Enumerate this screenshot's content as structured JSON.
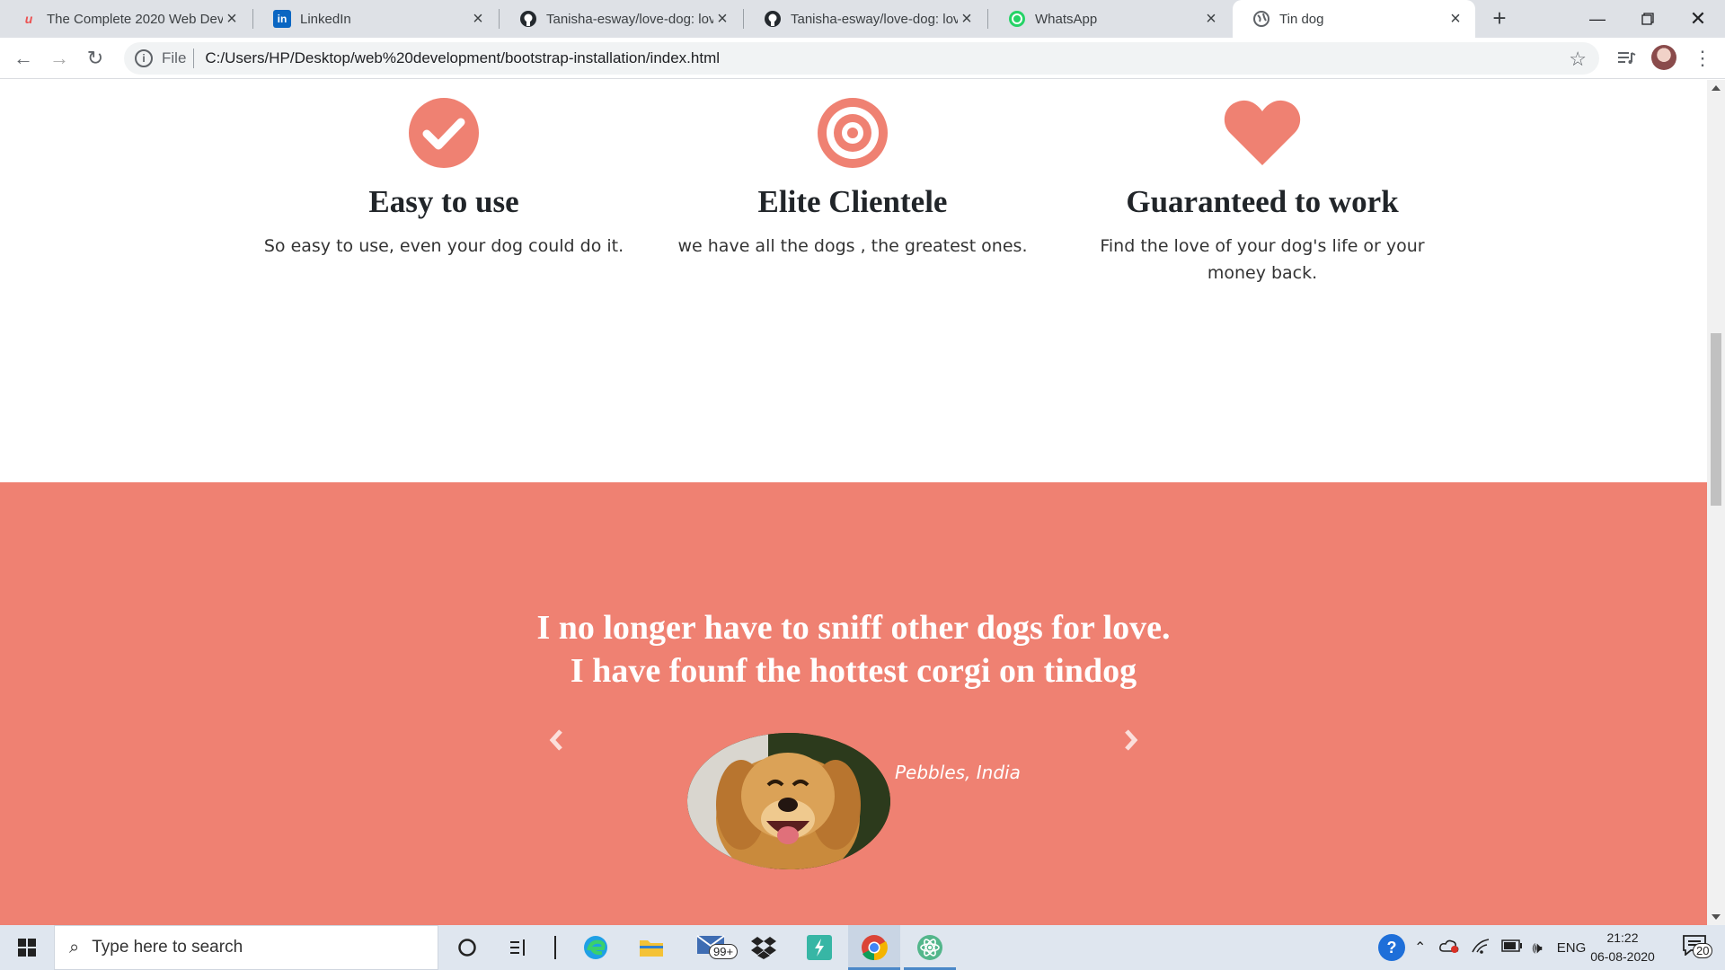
{
  "browser": {
    "tabs": [
      {
        "title": "The Complete 2020 Web Dev",
        "icon": "udemy-icon",
        "active": false
      },
      {
        "title": "LinkedIn",
        "icon": "linkedin-icon",
        "active": false
      },
      {
        "title": "Tanisha-esway/love-dog: lov",
        "icon": "github-icon",
        "active": false
      },
      {
        "title": "Tanisha-esway/love-dog: lov",
        "icon": "github-icon",
        "active": false
      },
      {
        "title": "WhatsApp",
        "icon": "whatsapp-icon",
        "active": false
      },
      {
        "title": "Tin dog",
        "icon": "globe-icon",
        "active": true
      }
    ],
    "new_tab_label": "+",
    "address": {
      "scheme": "File",
      "url": "C:/Users/HP/Desktop/web%20development/bootstrap-installation/index.html"
    }
  },
  "features": [
    {
      "icon": "check-circle-icon",
      "title": "Easy to use",
      "text": "So easy to use, even your dog could do it."
    },
    {
      "icon": "bullseye-icon",
      "title": "Elite Clientele",
      "text": "we have all the dogs , the greatest ones."
    },
    {
      "icon": "heart-icon",
      "title": "Guaranteed to work",
      "text": "Find the love of your dog's life or your money back."
    }
  ],
  "testimonial": {
    "quote_line1": "I no longer have to sniff other dogs for love.",
    "quote_line2": "I have founf the hottest corgi on tindog",
    "caption": "Pebbles, India"
  },
  "taskbar": {
    "search_placeholder": "Type here to search",
    "mail_badge": "99+",
    "language": "ENG",
    "time": "21:22",
    "date": "06-08-2020",
    "notification_count": "20"
  },
  "colors": {
    "accent": "#ef8172",
    "heading": "#212529"
  }
}
